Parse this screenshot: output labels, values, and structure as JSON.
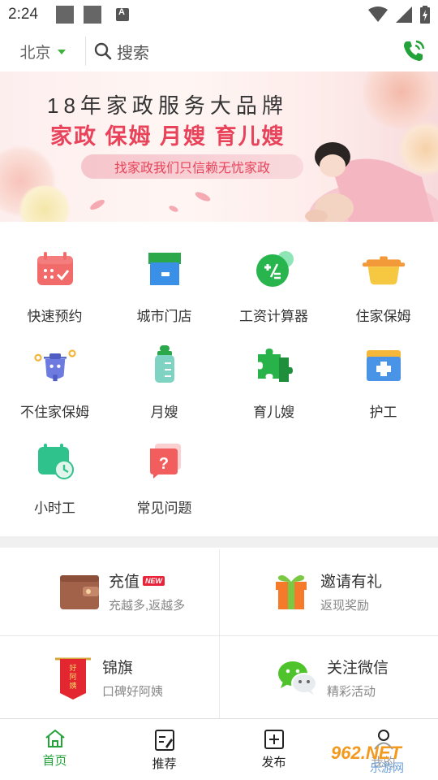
{
  "status_bar": {
    "time": "2:24"
  },
  "header": {
    "city": "北京",
    "search_placeholder": "搜索"
  },
  "banner": {
    "title": "18年家政服务大品牌",
    "subtitle": "家政 保姆 月嫂 育儿嫂",
    "slogan": "找家政我们只信赖无忧家政"
  },
  "grid": [
    {
      "label": "快速预约",
      "icon": "calendar-icon"
    },
    {
      "label": "城市门店",
      "icon": "store-icon"
    },
    {
      "label": "工资计算器",
      "icon": "calculator-icon"
    },
    {
      "label": "住家保姆",
      "icon": "pot-icon"
    },
    {
      "label": "不住家保姆",
      "icon": "scooter-icon"
    },
    {
      "label": "月嫂",
      "icon": "baby-bottle-icon"
    },
    {
      "label": "育儿嫂",
      "icon": "puzzle-icon"
    },
    {
      "label": "护工",
      "icon": "medical-kit-icon"
    },
    {
      "label": "小时工",
      "icon": "clock-calendar-icon"
    },
    {
      "label": "常见问题",
      "icon": "question-icon"
    }
  ],
  "cards": [
    {
      "title": "充值",
      "badge": "NEW",
      "sub": "充越多,返越多",
      "icon": "wallet-icon"
    },
    {
      "title": "邀请有礼",
      "sub": "返现奖励",
      "icon": "gift-icon"
    },
    {
      "title": "锦旗",
      "sub": "口碑好阿姨",
      "icon": "banner-flag-icon",
      "flag_text": "好阿姨"
    },
    {
      "title": "关注微信",
      "sub": "精彩活动",
      "icon": "wechat-icon"
    }
  ],
  "tabs": [
    {
      "label": "首页",
      "active": true,
      "icon": "home-icon"
    },
    {
      "label": "推荐",
      "icon": "recommend-icon"
    },
    {
      "label": "发布",
      "icon": "publish-icon"
    },
    {
      "label": "我的",
      "icon": "user-icon"
    }
  ],
  "watermark": {
    "brand": "962.NET",
    "text": "乐游网"
  },
  "colors": {
    "accent": "#23a23a",
    "brand_red": "#e8435a"
  }
}
